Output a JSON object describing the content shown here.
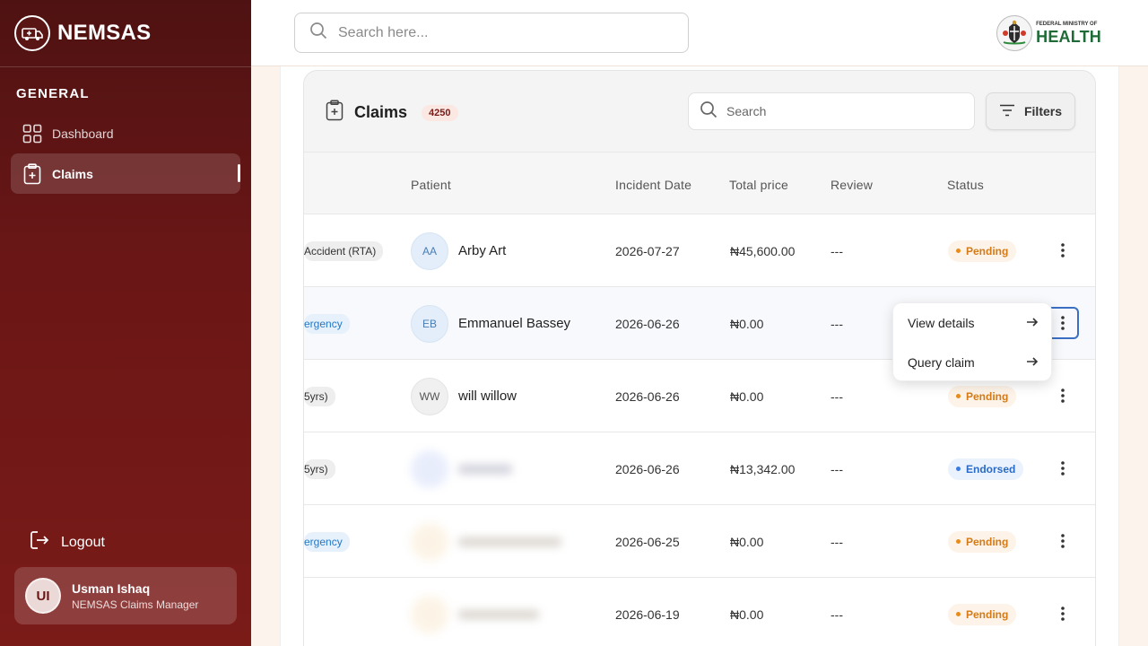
{
  "sidebar": {
    "brand": "NEMSAS",
    "section_label": "GENERAL",
    "items": [
      {
        "label": "Dashboard",
        "icon": "grid-icon"
      },
      {
        "label": "Claims",
        "icon": "clipboard-plus-icon",
        "active": true
      }
    ],
    "logout_label": "Logout",
    "user": {
      "initials": "UI",
      "name": "Usman Ishaq",
      "role": "NEMSAS Claims Manager"
    }
  },
  "topbar": {
    "search_placeholder": "Search here...",
    "ministry_small": "FEDERAL MINISTRY OF",
    "ministry_big": "HEALTH"
  },
  "claims": {
    "title": "Claims",
    "count": "4250",
    "search_placeholder": "Search",
    "filters_label": "Filters",
    "columns": [
      "Patient",
      "Incident Date",
      "Total price",
      "Review",
      "Status"
    ],
    "rows": [
      {
        "type": "Accident (RTA)",
        "type_style": "gray",
        "initials": "AA",
        "patient": "Arby Art",
        "date": "2026-07-27",
        "price": "₦45,600.00",
        "review": "---",
        "status": "Pending"
      },
      {
        "type": "ergency",
        "type_style": "blue",
        "initials": "EB",
        "patient": "Emmanuel Bassey",
        "date": "2026-06-26",
        "price": "₦0.00",
        "review": "---",
        "status": ""
      },
      {
        "type": "5yrs)",
        "type_style": "gray",
        "initials": "WW",
        "patient": "will willow",
        "date": "2026-06-26",
        "price": "₦0.00",
        "review": "---",
        "status": "Pending"
      },
      {
        "type": "5yrs)",
        "type_style": "gray",
        "initials": "",
        "patient": "",
        "date": "2026-06-26",
        "price": "₦13,342.00",
        "review": "---",
        "status": "Endorsed"
      },
      {
        "type": "ergency",
        "type_style": "blue",
        "initials": "",
        "patient": "",
        "date": "2026-06-25",
        "price": "₦0.00",
        "review": "---",
        "status": "Pending"
      },
      {
        "type": "",
        "type_style": "gray",
        "initials": "",
        "patient": "",
        "date": "2026-06-19",
        "price": "₦0.00",
        "review": "---",
        "status": "Pending"
      }
    ]
  },
  "dropdown": {
    "items": [
      "View details",
      "Query claim"
    ]
  },
  "colors": {
    "brand_dark": "#4f1212",
    "brand": "#7a1b18",
    "pending": "#e88b1c",
    "endorsed": "#3a7be0",
    "focus": "#3a6fc4"
  }
}
